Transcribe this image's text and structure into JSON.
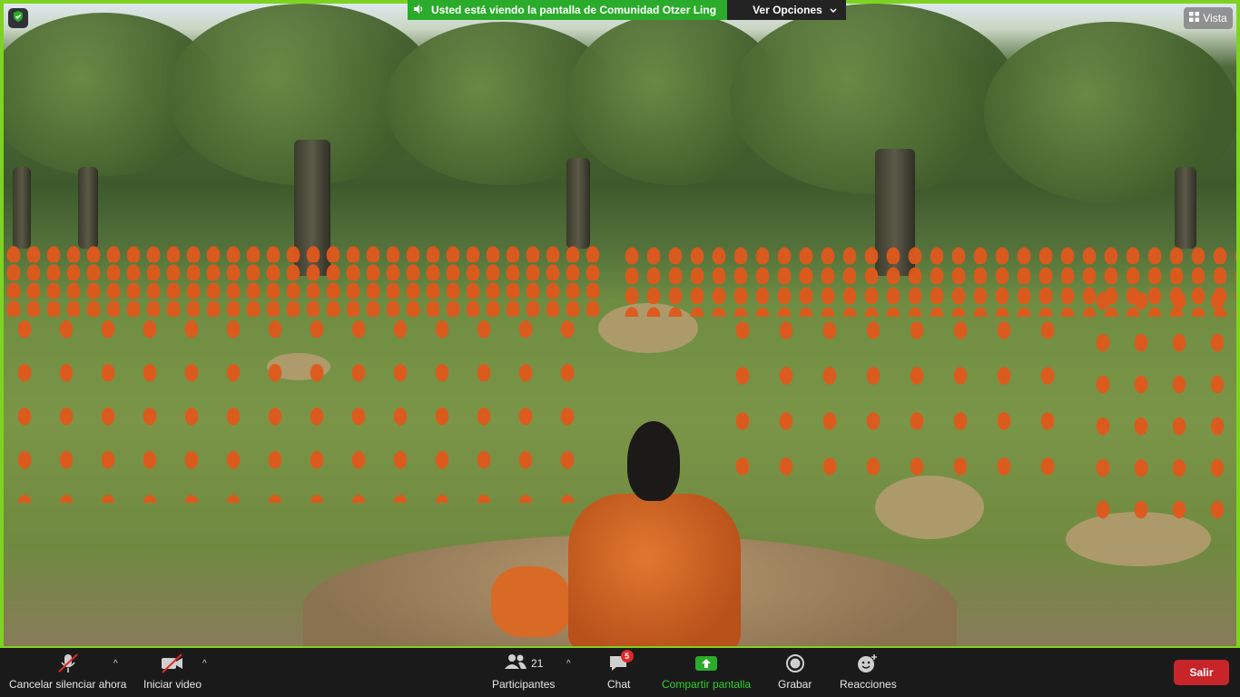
{
  "app": "Zoom Meeting",
  "banner": {
    "sharing_text": "Usted está viendo la pantalla de Comunidad Otzer Ling",
    "view_options_label": "Ver Opciones"
  },
  "view_button_label": "Vista",
  "toolbar": {
    "audio_label": "Cancelar silenciar ahora",
    "video_label": "Iniciar video",
    "participants_label": "Participantes",
    "participants_count": "21",
    "chat_label": "Chat",
    "chat_badge": "5",
    "share_label": "Compartir pantalla",
    "record_label": "Grabar",
    "reactions_label": "Reacciones",
    "leave_label": "Salir"
  },
  "icons": {
    "security": "shield-check-icon",
    "audio": "microphone-muted-icon",
    "video": "camera-off-icon",
    "participants": "people-icon",
    "chat": "chat-bubble-icon",
    "share": "share-screen-icon",
    "record": "record-icon",
    "reactions": "smiley-plus-icon"
  },
  "colors": {
    "share_border": "#7ed321",
    "share_banner": "#2bab2b",
    "share_label": "#2ed02e",
    "leave_button": "#c8252a",
    "badge": "#e02828"
  }
}
